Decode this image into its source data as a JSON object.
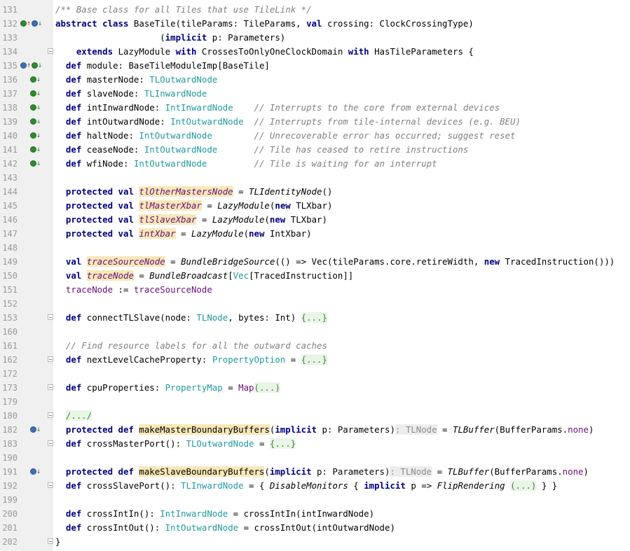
{
  "editor": {
    "lines": [
      {
        "n": "131",
        "marks": [],
        "fold": false,
        "t": [
          [
            "cm",
            "/** Base class for all Tiles that use TileLink */"
          ]
        ]
      },
      {
        "n": "132",
        "marks": [
          "o-up",
          "b-dn"
        ],
        "fold": false,
        "t": [
          [
            "kw",
            "abstract class "
          ],
          [
            "",
            "BaseTile(tileParams: TileParams, "
          ],
          [
            "kw",
            "val "
          ],
          [
            "",
            "crossing: ClockCrossingType)"
          ]
        ]
      },
      {
        "n": "133",
        "marks": [],
        "fold": false,
        "t": [
          [
            "",
            "                    ("
          ],
          [
            "kw",
            "implicit "
          ],
          [
            "",
            "p: Parameters)"
          ]
        ]
      },
      {
        "n": "134",
        "marks": [],
        "fold": true,
        "t": [
          [
            "",
            "    "
          ],
          [
            "kw",
            "extends "
          ],
          [
            "",
            "LazyModule "
          ],
          [
            "kw",
            "with "
          ],
          [
            "",
            "CrossesToOnlyOneClockDomain "
          ],
          [
            "kw",
            "with "
          ],
          [
            "",
            "HasTileParameters {"
          ]
        ]
      },
      {
        "n": "135",
        "marks": [
          "b-up",
          "o-dn"
        ],
        "fold": false,
        "t": [
          [
            "",
            "  "
          ],
          [
            "kw",
            "def "
          ],
          [
            "",
            "module: BaseTileModuleImp[BaseTile]"
          ]
        ]
      },
      {
        "n": "136",
        "marks": [
          "o-dn"
        ],
        "fold": false,
        "t": [
          [
            "",
            "  "
          ],
          [
            "kw",
            "def "
          ],
          [
            "",
            "masterNode: "
          ],
          [
            "ty",
            "TLOutwardNode"
          ]
        ]
      },
      {
        "n": "137",
        "marks": [
          "o-dn"
        ],
        "fold": false,
        "t": [
          [
            "",
            "  "
          ],
          [
            "kw",
            "def "
          ],
          [
            "",
            "slaveNode: "
          ],
          [
            "ty",
            "TLInwardNode"
          ]
        ]
      },
      {
        "n": "138",
        "marks": [
          "o-dn"
        ],
        "fold": false,
        "t": [
          [
            "",
            "  "
          ],
          [
            "kw",
            "def "
          ],
          [
            "",
            "intInwardNode: "
          ],
          [
            "ty",
            "IntInwardNode"
          ],
          [
            "",
            "    "
          ],
          [
            "cm",
            "// Interrupts to the core from external devices"
          ]
        ]
      },
      {
        "n": "139",
        "marks": [
          "o-dn"
        ],
        "fold": false,
        "t": [
          [
            "",
            "  "
          ],
          [
            "kw",
            "def "
          ],
          [
            "",
            "intOutwardNode: "
          ],
          [
            "ty",
            "IntOutwardNode"
          ],
          [
            "",
            "  "
          ],
          [
            "cm",
            "// Interrupts from tile-internal devices (e.g. BEU)"
          ]
        ]
      },
      {
        "n": "140",
        "marks": [
          "o-dn"
        ],
        "fold": false,
        "t": [
          [
            "",
            "  "
          ],
          [
            "kw",
            "def "
          ],
          [
            "",
            "haltNode: "
          ],
          [
            "ty",
            "IntOutwardNode"
          ],
          [
            "",
            "        "
          ],
          [
            "cm",
            "// Unrecoverable error has occurred; suggest reset"
          ]
        ]
      },
      {
        "n": "141",
        "marks": [
          "o-dn"
        ],
        "fold": false,
        "t": [
          [
            "",
            "  "
          ],
          [
            "kw",
            "def "
          ],
          [
            "",
            "ceaseNode: "
          ],
          [
            "ty",
            "IntOutwardNode"
          ],
          [
            "",
            "       "
          ],
          [
            "cm",
            "// Tile has ceased to retire instructions"
          ]
        ]
      },
      {
        "n": "142",
        "marks": [
          "o-dn"
        ],
        "fold": false,
        "t": [
          [
            "",
            "  "
          ],
          [
            "kw",
            "def "
          ],
          [
            "",
            "wfiNode: "
          ],
          [
            "ty",
            "IntOutwardNode"
          ],
          [
            "",
            "         "
          ],
          [
            "cm",
            "// Tile is waiting for an interrupt"
          ]
        ]
      },
      {
        "n": "143",
        "marks": [],
        "fold": false,
        "t": []
      },
      {
        "n": "144",
        "marks": [],
        "fold": false,
        "t": [
          [
            "",
            "  "
          ],
          [
            "kw",
            "protected val "
          ],
          [
            "tv",
            "tlOtherMastersNode"
          ],
          [
            "",
            " = "
          ],
          [
            "it",
            "TLIdentityNode"
          ],
          [
            "",
            "()"
          ]
        ]
      },
      {
        "n": "145",
        "marks": [],
        "fold": false,
        "t": [
          [
            "",
            "  "
          ],
          [
            "kw",
            "protected val "
          ],
          [
            "tv",
            "tlMasterXbar"
          ],
          [
            "",
            " = "
          ],
          [
            "it",
            "LazyModule"
          ],
          [
            "",
            "("
          ],
          [
            "kw",
            "new "
          ],
          [
            "",
            "TLXbar)"
          ]
        ]
      },
      {
        "n": "146",
        "marks": [],
        "fold": false,
        "t": [
          [
            "",
            "  "
          ],
          [
            "kw",
            "protected val "
          ],
          [
            "tv",
            "tlSlaveXbar"
          ],
          [
            "",
            " = "
          ],
          [
            "it",
            "LazyModule"
          ],
          [
            "",
            "("
          ],
          [
            "kw",
            "new "
          ],
          [
            "",
            "TLXbar)"
          ]
        ]
      },
      {
        "n": "147",
        "marks": [],
        "fold": false,
        "t": [
          [
            "",
            "  "
          ],
          [
            "kw",
            "protected val "
          ],
          [
            "tv",
            "intXbar"
          ],
          [
            "",
            " = "
          ],
          [
            "it",
            "LazyModule"
          ],
          [
            "",
            "("
          ],
          [
            "kw",
            "new "
          ],
          [
            "",
            "IntXbar)"
          ]
        ]
      },
      {
        "n": "148",
        "marks": [],
        "fold": false,
        "t": []
      },
      {
        "n": "149",
        "marks": [],
        "fold": false,
        "t": [
          [
            "",
            "  "
          ],
          [
            "kw",
            "val "
          ],
          [
            "tv",
            "traceSourceNode"
          ],
          [
            "",
            " = "
          ],
          [
            "it",
            "BundleBridgeSource"
          ],
          [
            "",
            "(() => Vec(tileParams.core.retireWidth, "
          ],
          [
            "kw",
            "new "
          ],
          [
            "",
            "TracedInstruction()))"
          ]
        ]
      },
      {
        "n": "150",
        "marks": [],
        "fold": false,
        "t": [
          [
            "",
            "  "
          ],
          [
            "kw",
            "val "
          ],
          [
            "tv",
            "traceNode"
          ],
          [
            "",
            " = "
          ],
          [
            "it",
            "BundleBroadcast"
          ],
          [
            "",
            "["
          ],
          [
            "ty",
            "Vec"
          ],
          [
            "",
            "[TracedInstruction]]"
          ]
        ]
      },
      {
        "n": "151",
        "marks": [],
        "fold": false,
        "t": [
          [
            "",
            "  "
          ],
          [
            "pv",
            "traceNode"
          ],
          [
            "",
            " := "
          ],
          [
            "pv",
            "traceSourceNode"
          ]
        ]
      },
      {
        "n": "152",
        "marks": [],
        "fold": false,
        "t": []
      },
      {
        "n": "153",
        "marks": [],
        "fold": true,
        "t": [
          [
            "",
            "  "
          ],
          [
            "kw",
            "def "
          ],
          [
            "",
            "connectTLSlave(node: "
          ],
          [
            "ty",
            "TLNode"
          ],
          [
            "",
            ", bytes: Int) "
          ],
          [
            "fd",
            "{...}"
          ]
        ]
      },
      {
        "n": "160",
        "marks": [],
        "fold": false,
        "t": []
      },
      {
        "n": "161",
        "marks": [],
        "fold": false,
        "t": [
          [
            "",
            "  "
          ],
          [
            "cm",
            "// Find resource labels for all the outward caches"
          ]
        ]
      },
      {
        "n": "162",
        "marks": [],
        "fold": true,
        "t": [
          [
            "",
            "  "
          ],
          [
            "kw",
            "def "
          ],
          [
            "",
            "nextLevelCacheProperty: "
          ],
          [
            "ty",
            "PropertyOption"
          ],
          [
            "",
            " = "
          ],
          [
            "fd",
            "{...}"
          ]
        ]
      },
      {
        "n": "172",
        "marks": [],
        "fold": false,
        "t": []
      },
      {
        "n": "173",
        "marks": [],
        "fold": true,
        "t": [
          [
            "",
            "  "
          ],
          [
            "kw",
            "def "
          ],
          [
            "",
            "cpuProperties: "
          ],
          [
            "ty",
            "PropertyMap"
          ],
          [
            "",
            " = "
          ],
          [
            "pv",
            "Map"
          ],
          [
            "fd",
            "(...)"
          ]
        ]
      },
      {
        "n": "179",
        "marks": [],
        "fold": false,
        "t": []
      },
      {
        "n": "180",
        "marks": [],
        "fold": true,
        "t": [
          [
            "",
            "  "
          ],
          [
            "fd",
            "/.../"
          ]
        ]
      },
      {
        "n": "182",
        "marks": [
          "b-dn"
        ],
        "fold": false,
        "t": [
          [
            "",
            "  "
          ],
          [
            "kw",
            "protected def "
          ],
          [
            "mdef",
            "makeMasterBoundaryBuffers"
          ],
          [
            "",
            "("
          ],
          [
            "kw",
            "implicit "
          ],
          [
            "",
            "p: Parameters)"
          ],
          [
            "hint",
            ": TLNode"
          ],
          [
            "",
            " = "
          ],
          [
            "it",
            "TLBuffer"
          ],
          [
            "",
            "(BufferParams."
          ],
          [
            "pv",
            "none"
          ],
          [
            "",
            ")"
          ]
        ]
      },
      {
        "n": "183",
        "marks": [],
        "fold": true,
        "t": [
          [
            "",
            "  "
          ],
          [
            "kw",
            "def "
          ],
          [
            "",
            "crossMasterPort(): "
          ],
          [
            "ty",
            "TLOutwardNode"
          ],
          [
            "",
            " = "
          ],
          [
            "fd",
            "{...}"
          ]
        ]
      },
      {
        "n": "190",
        "marks": [],
        "fold": false,
        "t": []
      },
      {
        "n": "191",
        "marks": [
          "b-dn"
        ],
        "fold": false,
        "t": [
          [
            "",
            "  "
          ],
          [
            "kw",
            "protected def "
          ],
          [
            "mdef",
            "makeSlaveBoundaryBuffers"
          ],
          [
            "",
            "("
          ],
          [
            "kw",
            "implicit "
          ],
          [
            "",
            "p: Parameters)"
          ],
          [
            "hint",
            ": TLNode"
          ],
          [
            "",
            " = "
          ],
          [
            "it",
            "TLBuffer"
          ],
          [
            "",
            "(BufferParams."
          ],
          [
            "pv",
            "none"
          ],
          [
            "",
            ")"
          ]
        ]
      },
      {
        "n": "192",
        "marks": [],
        "fold": true,
        "t": [
          [
            "",
            "  "
          ],
          [
            "kw",
            "def "
          ],
          [
            "",
            "crossSlavePort(): "
          ],
          [
            "ty",
            "TLInwardNode"
          ],
          [
            "",
            " = { "
          ],
          [
            "it",
            "DisableMonitors"
          ],
          [
            "",
            " { "
          ],
          [
            "kw",
            "implicit "
          ],
          [
            "",
            "p => "
          ],
          [
            "it",
            "FlipRendering"
          ],
          [
            "",
            " "
          ],
          [
            "fd",
            "(...)"
          ],
          [
            "",
            " } }"
          ]
        ]
      },
      {
        "n": "199",
        "marks": [],
        "fold": false,
        "t": []
      },
      {
        "n": "200",
        "marks": [],
        "fold": false,
        "t": [
          [
            "",
            "  "
          ],
          [
            "kw",
            "def "
          ],
          [
            "",
            "crossIntIn(): "
          ],
          [
            "ty",
            "IntInwardNode"
          ],
          [
            "",
            " = crossIntIn(intInwardNode)"
          ]
        ]
      },
      {
        "n": "201",
        "marks": [],
        "fold": false,
        "t": [
          [
            "",
            "  "
          ],
          [
            "kw",
            "def "
          ],
          [
            "",
            "crossIntOut(): "
          ],
          [
            "ty",
            "IntOutwardNode"
          ],
          [
            "",
            " = crossIntOut(intOutwardNode)"
          ]
        ]
      },
      {
        "n": "202",
        "marks": [],
        "fold": true,
        "t": [
          [
            "",
            "}"
          ]
        ]
      }
    ]
  }
}
